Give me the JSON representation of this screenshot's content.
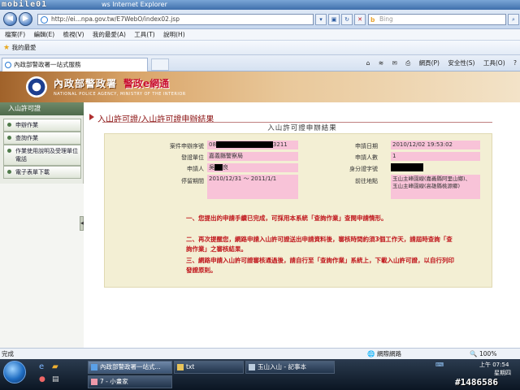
{
  "window": {
    "logo_text": "mobile01",
    "title": "ws Internet Explorer"
  },
  "address_bar": {
    "url": "http://ei...npa.gov.tw/E7WebO/index02.jsp",
    "search_placeholder": "Bing",
    "search_logo": "b"
  },
  "menu": [
    "檔案(F)",
    "編輯(E)",
    "檢視(V)",
    "我的最愛(A)",
    "工具(T)",
    "說明(H)"
  ],
  "favorites_bar": {
    "label": "我的最愛"
  },
  "tab": {
    "title": "內政部警政署一站式服務"
  },
  "command_bar": {
    "page": "網頁(P)",
    "safety": "安全性(S)",
    "tools": "工具(O)"
  },
  "banner": {
    "agency": "內政部警政署",
    "site": "警政e網通",
    "english": "NATIONAL POLICE AGENCY, MINISTRY OF THE INTERIOR"
  },
  "sidebar": {
    "header": "入山許可證",
    "items": [
      {
        "label": "申辦作業"
      },
      {
        "label": "查詢作業"
      },
      {
        "label": "作業使用說明及受理單位電話"
      },
      {
        "label": "電子表單下載"
      }
    ]
  },
  "main": {
    "title": "入山許可證/入山許可證申辦結果",
    "subtitle": "入山許可證申辦結果",
    "fields": {
      "case_no_label": "案件申辦序號",
      "case_no_prefix": "08",
      "case_no_suffix": "3211",
      "date_label": "申請日期",
      "date_value": "2010/12/02 19:53:02",
      "issuer_label": "發證單位",
      "issuer_value": "嘉義縣警察局",
      "people_label": "申請人數",
      "people_value": "1",
      "applicant_label": "申請人",
      "applicant_first": "吳",
      "applicant_last": "良",
      "id_label": "身分證字號",
      "period_label": "停留期間",
      "period_value": "2010/12/31 ～ 2011/1/1",
      "destination_label": "前往地點",
      "destination_value_1": "玉山主峰園線(嘉義縣阿里山鄉)、",
      "destination_value_2": "玉山主峰園線(高雄縣桃源鄉)"
    },
    "notes": [
      "一、您提出的申請手續已完成，可採用本系統「查詢作業」查閱申請情形。",
      "二、再次提醒您，網路申請入山許可證送出申請資料後，審核時間約須3個工作天，請屆時查詢「查詢作業」之審核結果。",
      "三、網路申請入山許可證審核通過後，請自行至「查詢作業」系統上，下載入山許可證，以自行列印發證原則。"
    ]
  },
  "status_bar": {
    "left": "完成",
    "zone": "網際網路",
    "zoom": "100%"
  },
  "taskbar": {
    "buttons": [
      "內政部警政署一站式...",
      "txt",
      "玉山入山 - 記事本",
      "7 - 小畫家"
    ],
    "time": "上午 07:54",
    "day": "星期四",
    "date": "2010/12/2"
  },
  "watermark": "#1486586"
}
